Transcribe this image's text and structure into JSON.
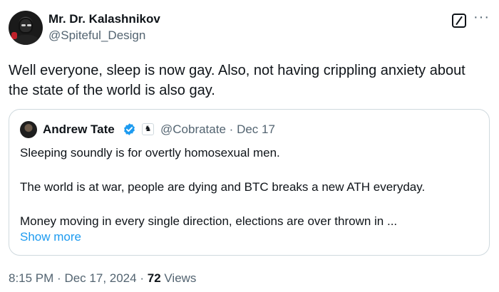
{
  "tweet": {
    "author_name": "Mr. Dr. Kalashnikov",
    "author_handle": "@Spiteful_Design",
    "text": "Well everyone, sleep is now gay. Also, not having crippling anxiety about the state of the world is also gay.",
    "time": "8:15 PM",
    "date": "Dec 17, 2024",
    "views_count": "72",
    "views_label": "Views",
    "separator": "·"
  },
  "quote": {
    "author_name": "Andrew Tate",
    "affiliate_badge": "♞",
    "author_handle": "@Cobratate",
    "date": "Dec 17",
    "lines": [
      "Sleeping soundly is for overtly homosexual men.",
      "The world is at war, people are dying and BTC breaks a new ATH everyday.",
      "Money moving in every single direction, elections are over thrown in ..."
    ],
    "show_more": "Show more"
  },
  "icons": {
    "grok": "grok-icon",
    "more": "more-icon",
    "verified": "verified-badge-icon",
    "more_glyph": "···"
  },
  "colors": {
    "accent": "#1d9bf0",
    "muted": "#536471",
    "text": "#0f1419",
    "border": "#cfd9de"
  }
}
